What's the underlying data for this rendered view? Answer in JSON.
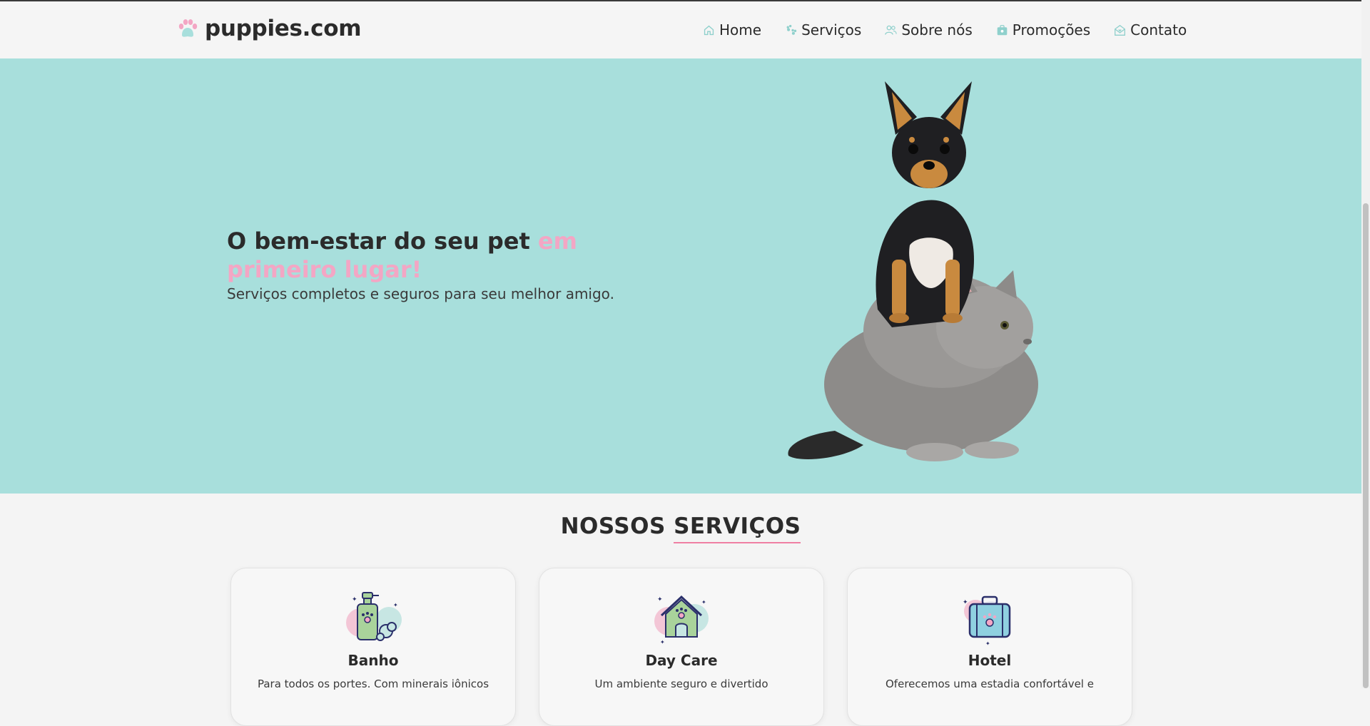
{
  "header": {
    "logo_text": "puppies.com",
    "nav": [
      {
        "label": "Home",
        "icon": "home-icon"
      },
      {
        "label": "Serviços",
        "icon": "paws-icon"
      },
      {
        "label": "Sobre nós",
        "icon": "users-icon"
      },
      {
        "label": "Promoções",
        "icon": "gift-icon"
      },
      {
        "label": "Contato",
        "icon": "mail-icon"
      }
    ]
  },
  "hero": {
    "title_main": "O bem-estar do seu pet ",
    "title_accent": "em primeiro lugar!",
    "subtitle": "Serviços completos e seguros para seu melhor amigo."
  },
  "services": {
    "title_part1": "NOSSOS ",
    "title_part2": "SERVIÇOS",
    "cards": [
      {
        "title": "Banho",
        "text": "Para todos os portes. Com minerais iônicos",
        "icon": "shampoo-icon"
      },
      {
        "title": "Day Care",
        "text": "Um ambiente seguro e divertido",
        "icon": "doghouse-icon"
      },
      {
        "title": "Hotel",
        "text": "Oferecemos uma estadia confortável e",
        "icon": "suitcase-icon"
      }
    ]
  },
  "colors": {
    "hero_bg": "#a8dfdc",
    "accent_pink": "#f3a6c4",
    "text_dark": "#2b2b2b",
    "page_bg": "#f4f4f4"
  }
}
